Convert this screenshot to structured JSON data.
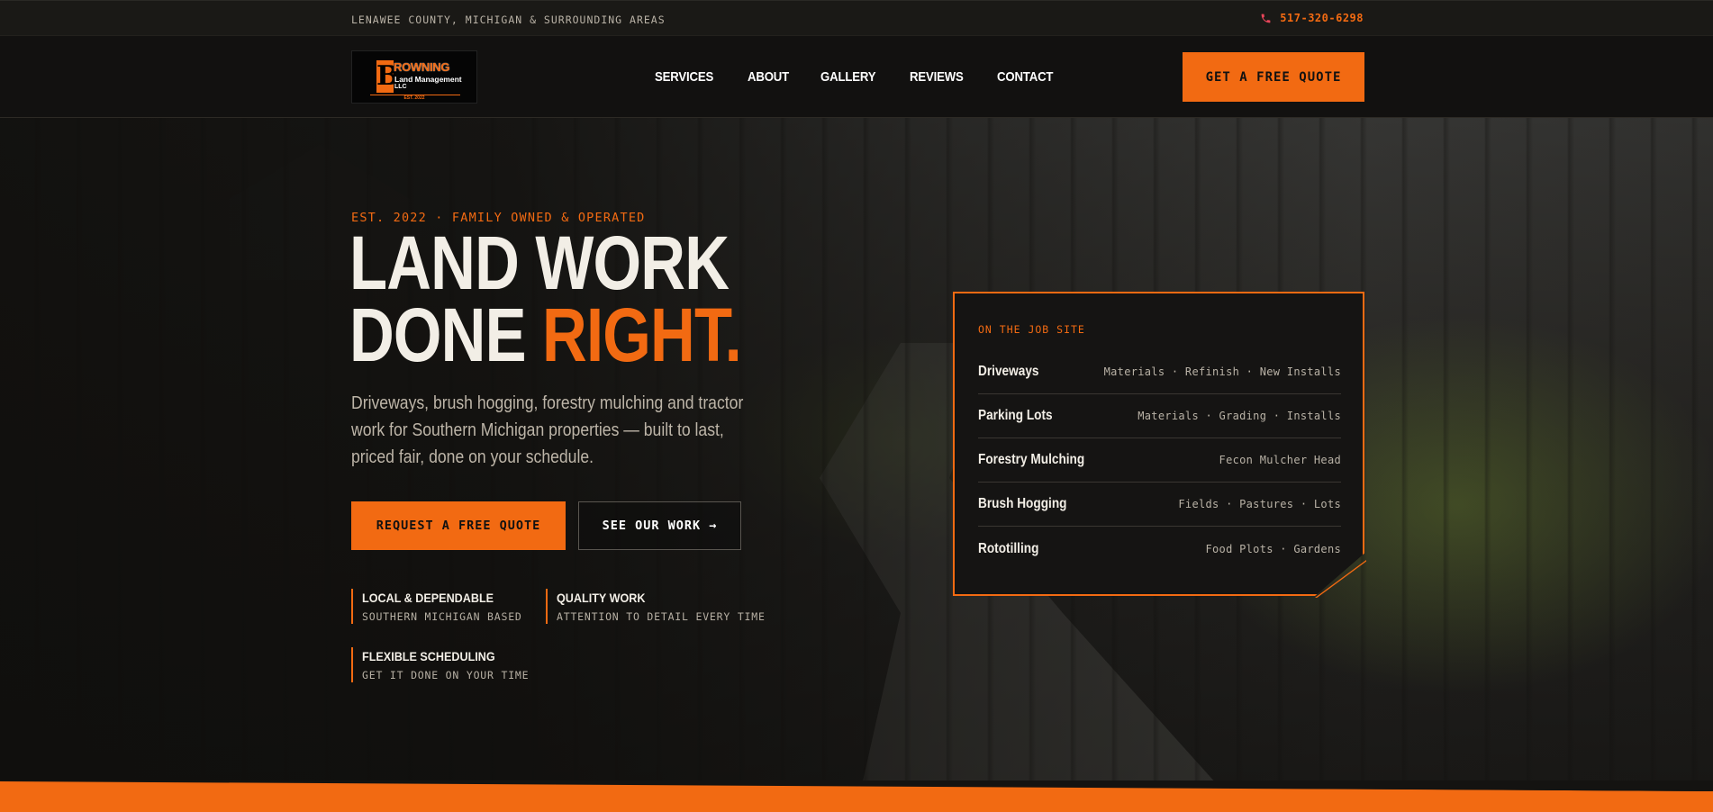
{
  "topbar": {
    "region": "LENAWEE COUNTY, MICHIGAN & SURROUNDING AREAS",
    "phone": "517-320-6298",
    "phone_icon": "phone-icon"
  },
  "logo": {
    "letter": "B",
    "word": "ROWNING",
    "line1": "Land Management",
    "line2": "LLC",
    "est": "EST. 2022"
  },
  "nav": {
    "items": [
      "SERVICES",
      "ABOUT",
      "GALLERY",
      "REVIEWS",
      "CONTACT"
    ]
  },
  "header_cta": "GET A FREE QUOTE",
  "hero": {
    "eyebrow": "EST. 2022 · FAMILY OWNED & OPERATED",
    "headline_line1": "LAND WORK",
    "headline_line2_a": "DONE ",
    "headline_line2_b": "RIGHT.",
    "lede": "Driveways, brush hogging, forestry mulching and tractor work for Southern Michigan properties — built to last, priced fair, done on your schedule.",
    "primary_cta": "REQUEST A FREE QUOTE",
    "secondary_cta": "SEE OUR WORK →",
    "features": [
      {
        "title": "LOCAL & DEPENDABLE",
        "subtitle": "SOUTHERN MICHIGAN BASED"
      },
      {
        "title": "QUALITY WORK",
        "subtitle": "ATTENTION TO DETAIL EVERY TIME"
      },
      {
        "title": "FLEXIBLE SCHEDULING",
        "subtitle": "GET IT DONE ON YOUR TIME"
      }
    ]
  },
  "job_card": {
    "label": "ON THE JOB SITE",
    "rows": [
      {
        "name": "Driveways",
        "detail": "Materials · Refinish · New Installs"
      },
      {
        "name": "Parking Lots",
        "detail": "Materials · Grading · Installs"
      },
      {
        "name": "Forestry Mulching",
        "detail": "Fecon Mulcher Head"
      },
      {
        "name": "Brush Hogging",
        "detail": "Fields · Pastures · Lots"
      },
      {
        "name": "Rototilling",
        "detail": "Food Plots · Gardens"
      }
    ]
  },
  "colors": {
    "accent": "#f26a12",
    "background": "#141311",
    "text": "#f2eee6"
  }
}
